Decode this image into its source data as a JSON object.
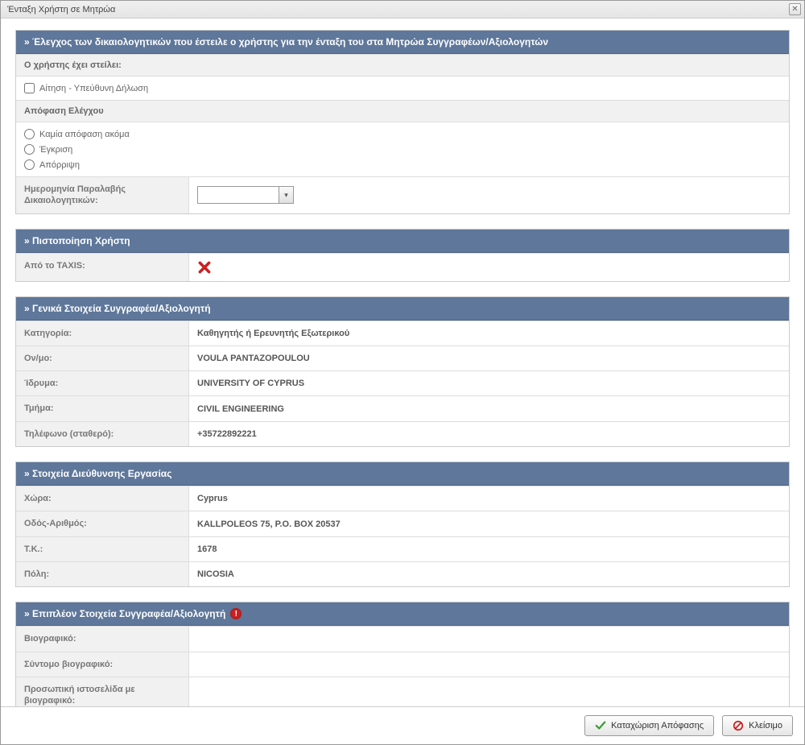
{
  "window": {
    "title": "Ένταξη Χρήστη σε Μητρώα"
  },
  "sections": {
    "check": {
      "header": "» Έλεγχος των δικαιολογητικών που έστειλε ο χρήστης για την ένταξη του στα Μητρώα Συγγραφέων/Αξιολογητών",
      "user_sent_label": "Ο χρήστης έχει στείλει:",
      "application_checkbox_label": "Αίτηση - Υπεύθυνη Δήλωση",
      "decision_label": "Απόφαση Ελέγχου",
      "options": {
        "none": "Καμία απόφαση ακόμα",
        "approve": "Έγκριση",
        "reject": "Απόρριψη"
      },
      "date_received_label": "Ημερομηνία Παραλαβής Δικαιολογητικών:"
    },
    "certification": {
      "header": "» Πιστοποίηση Χρήστη",
      "taxis_label": "Από το TAXIS:"
    },
    "general": {
      "header": "» Γενικά Στοιχεία Συγγραφέα/Αξιολογητή",
      "rows": {
        "category_label": "Κατηγορία:",
        "category_value": "Καθηγητής ή Ερευνητής Εξωτερικού",
        "name_label": "Ον/μο:",
        "name_value": "VOULA PANTAZOPOULOU",
        "institution_label": "Ίδρυμα:",
        "institution_value": "UNIVERSITY OF CYPRUS",
        "department_label": "Τμήμα:",
        "department_value": "CIVIL ENGINEERING",
        "phone_label": "Τηλέφωνο (σταθερό):",
        "phone_value": "+35722892221"
      }
    },
    "work_address": {
      "header": "» Στοιχεία Διεύθυνσης Εργασίας",
      "rows": {
        "country_label": "Χώρα:",
        "country_value": "Cyprus",
        "street_label": "Οδός-Αριθμός:",
        "street_value": "KALLPOLEOS 75, P.O. BOX 20537",
        "zip_label": "Τ.Κ.:",
        "zip_value": "1678",
        "city_label": "Πόλη:",
        "city_value": "NICOSIA"
      }
    },
    "extra": {
      "header": "» Επιπλέον Στοιχεία Συγγραφέα/Αξιολογητή",
      "rows": {
        "cv_label": "Βιογραφικό:",
        "cv_value": "",
        "short_cv_label": "Σύντομο βιογραφικό:",
        "short_cv_value": "",
        "website_label": "Προσωπική ιστοσελίδα με βιογραφικό:",
        "website_value": ""
      }
    }
  },
  "footer": {
    "save_label": "Καταχώριση Απόφασης",
    "close_label": "Κλείσιμο"
  }
}
